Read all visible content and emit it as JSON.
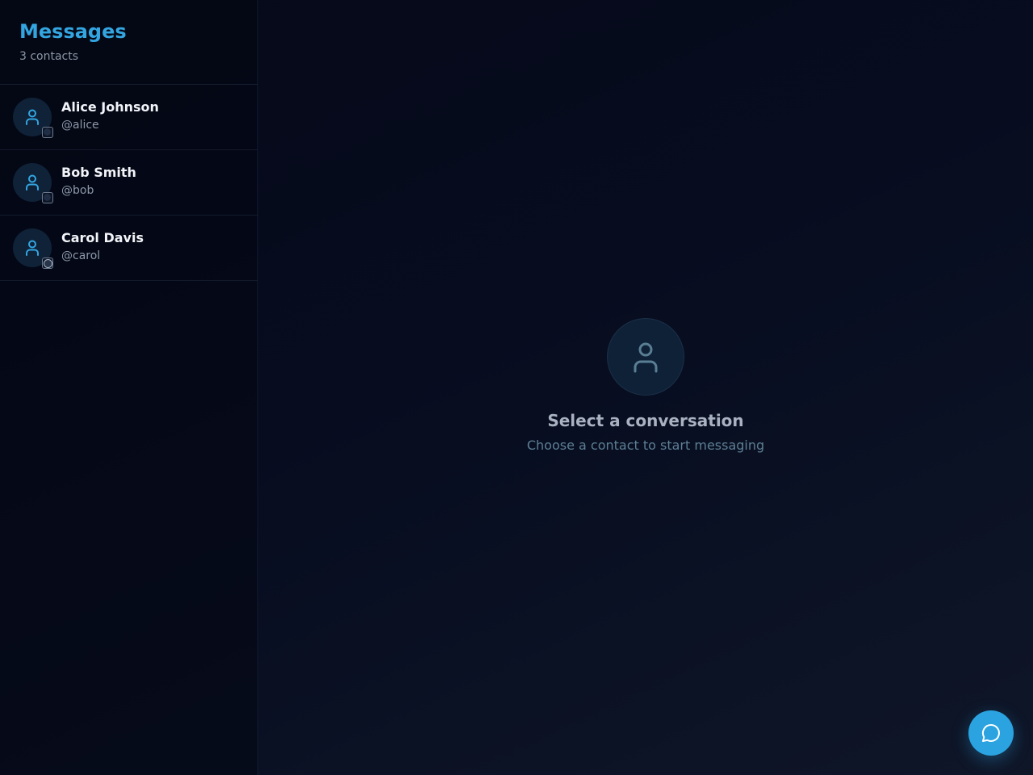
{
  "sidebar": {
    "title": "Messages",
    "subtitle": "3 contacts",
    "contacts": [
      {
        "name": "Alice Johnson",
        "handle": "@alice",
        "icon": "user-icon",
        "status": "offline"
      },
      {
        "name": "Bob Smith",
        "handle": "@bob",
        "icon": "user-icon",
        "status": "offline"
      },
      {
        "name": "Carol Davis",
        "handle": "@carol",
        "icon": "user-icon",
        "status": "online"
      }
    ]
  },
  "main": {
    "empty_state": {
      "icon": "user-icon",
      "title": "Select a conversation",
      "subtitle": "Choose a contact to start messaging"
    }
  },
  "fab": {
    "icon": "chat-bubble-icon"
  },
  "colors": {
    "accent": "#2aa3e0",
    "title": "#33a5e1",
    "background": "#070b1c"
  }
}
